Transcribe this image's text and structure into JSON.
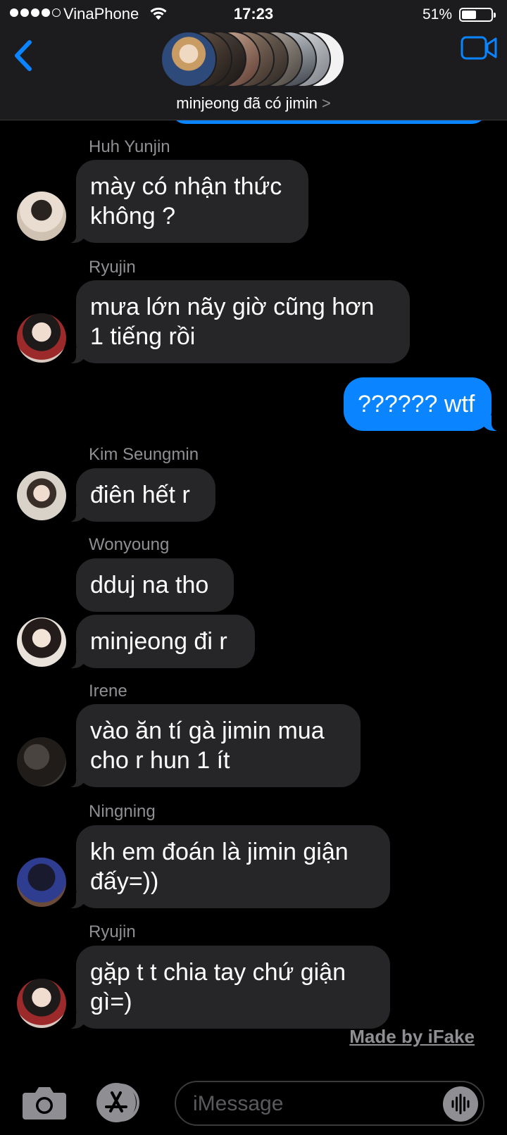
{
  "status_bar": {
    "carrier": "VinaPhone",
    "time": "17:23",
    "battery_percent": "51%",
    "battery_level": 0.51
  },
  "header": {
    "group_title": "minjeong đã có jimin",
    "chevron": ">"
  },
  "messages": [
    {
      "sender": "Huh Yunjin",
      "lines": [
        "mày có nhận thức",
        "không ?"
      ]
    },
    {
      "sender": "Ryujin",
      "lines": [
        "mưa lớn nãy giờ cũng hơn",
        "1 tiếng rồi"
      ]
    },
    {
      "outgoing": "?????? wtf"
    },
    {
      "sender": "Kim Seungmin",
      "lines": [
        "điên hết r"
      ]
    },
    {
      "sender": "Wonyoung",
      "lines": [
        "dduj na tho"
      ]
    },
    {
      "lines": [
        "minjeong đi r"
      ]
    },
    {
      "sender": "Irene",
      "lines": [
        "vào ăn tí gà jimin mua",
        "cho r hun 1 ít"
      ]
    },
    {
      "sender": "Ningning",
      "lines": [
        "kh em đoán là jimin giận",
        "đấy=))"
      ]
    },
    {
      "sender": "Ryujin",
      "lines": [
        "gặp t t chia tay chứ giận",
        "gì=)"
      ]
    }
  ],
  "watermark": "Made by iFake",
  "composer": {
    "placeholder": "iMessage"
  },
  "colors": {
    "accent": "#0a84ff",
    "incoming_bubble": "#262629",
    "background": "#000000"
  },
  "icons": [
    "back-chevron-icon",
    "video-camera-icon",
    "camera-icon",
    "app-store-icon",
    "audio-waveform-icon",
    "wifi-icon"
  ]
}
